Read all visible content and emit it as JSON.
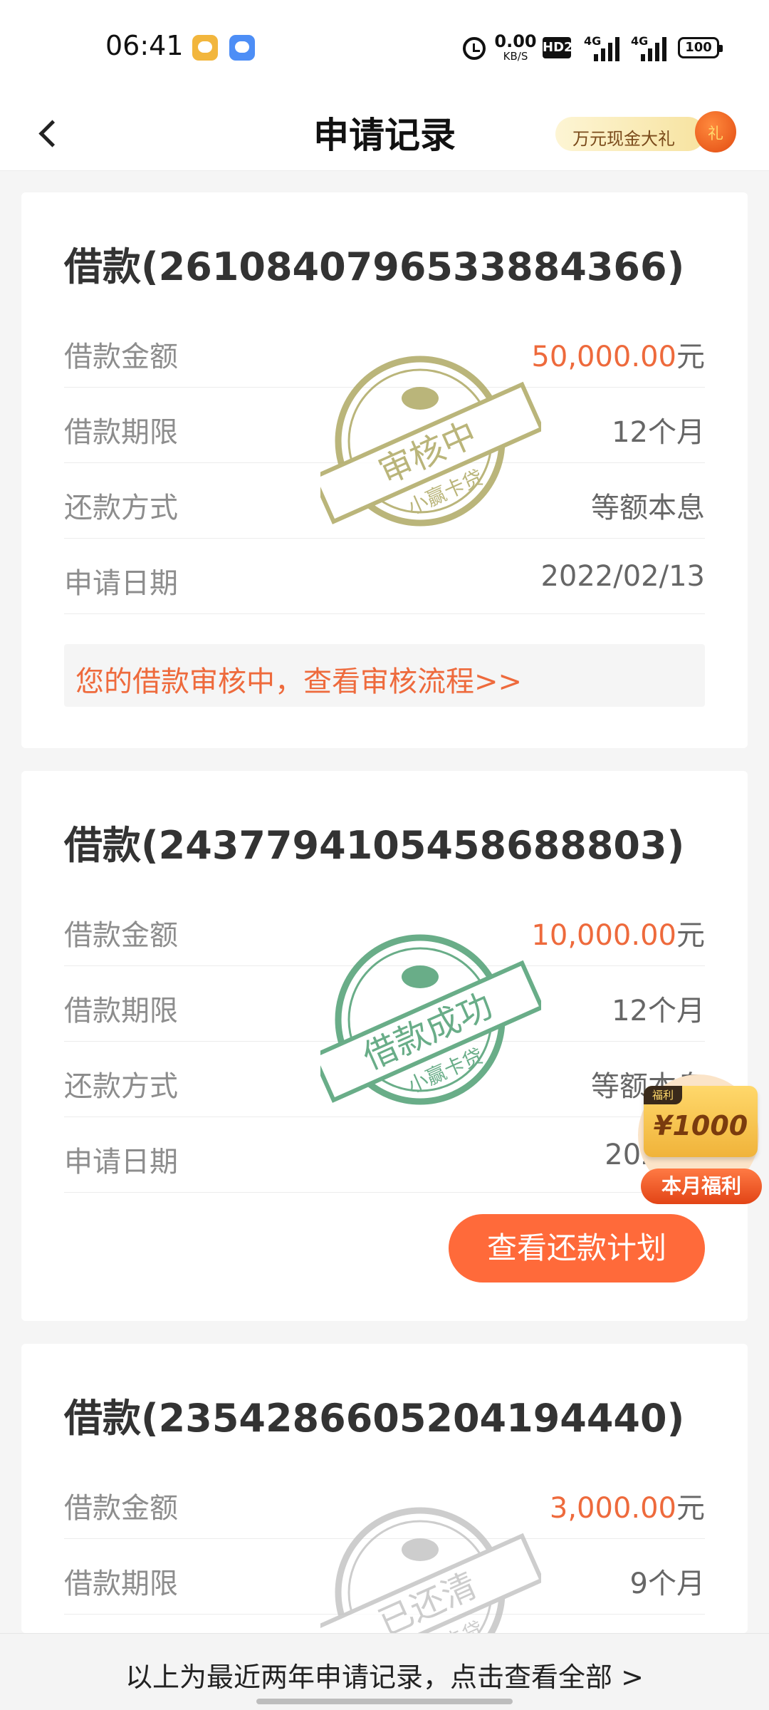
{
  "status_bar": {
    "time": "06:41",
    "net_speed_value": "0.00",
    "net_speed_unit": "KB/S",
    "hd_label": "HD2",
    "signal1_label": "4G",
    "signal2_label": "4G",
    "battery": "100"
  },
  "nav": {
    "title": "申请记录",
    "promo_text": "万元现金大礼"
  },
  "labels": {
    "amount": "借款金额",
    "term": "借款期限",
    "repay_method": "还款方式",
    "apply_date": "申请日期"
  },
  "loans": [
    {
      "title": "借款(2610840796533884366)",
      "amount": "50,000.00",
      "amount_unit": "元",
      "term": "12个月",
      "repay_method": "等额本息",
      "apply_date": "2022/02/13",
      "stamp_text": "审核中",
      "stamp_sub": "小赢卡贷",
      "notice": "您的借款审核中，查看审核流程>>"
    },
    {
      "title": "借款(2437794105458688803)",
      "amount": "10,000.00",
      "amount_unit": "元",
      "term": "12个月",
      "repay_method": "等额本息",
      "apply_date": "2021/0",
      "stamp_text": "借款成功",
      "stamp_sub": "小赢卡贷",
      "action_button": "查看还款计划"
    },
    {
      "title": "借款(2354286605204194440)",
      "amount": "3,000.00",
      "amount_unit": "元",
      "term": "9个月",
      "stamp_text": "已还清",
      "stamp_sub": "小赢卡贷"
    }
  ],
  "welfare": {
    "tag": "福利",
    "amount": "¥1000",
    "label": "本月福利"
  },
  "footer": {
    "text": "以上为最近两年申请记录，点击查看全部 >"
  },
  "colors": {
    "accent": "#ee6a3c",
    "button": "#ff6a3a",
    "stamp_review": "#a9a35a",
    "stamp_success": "#4f9f74",
    "stamp_paid": "#bdbdbd"
  }
}
